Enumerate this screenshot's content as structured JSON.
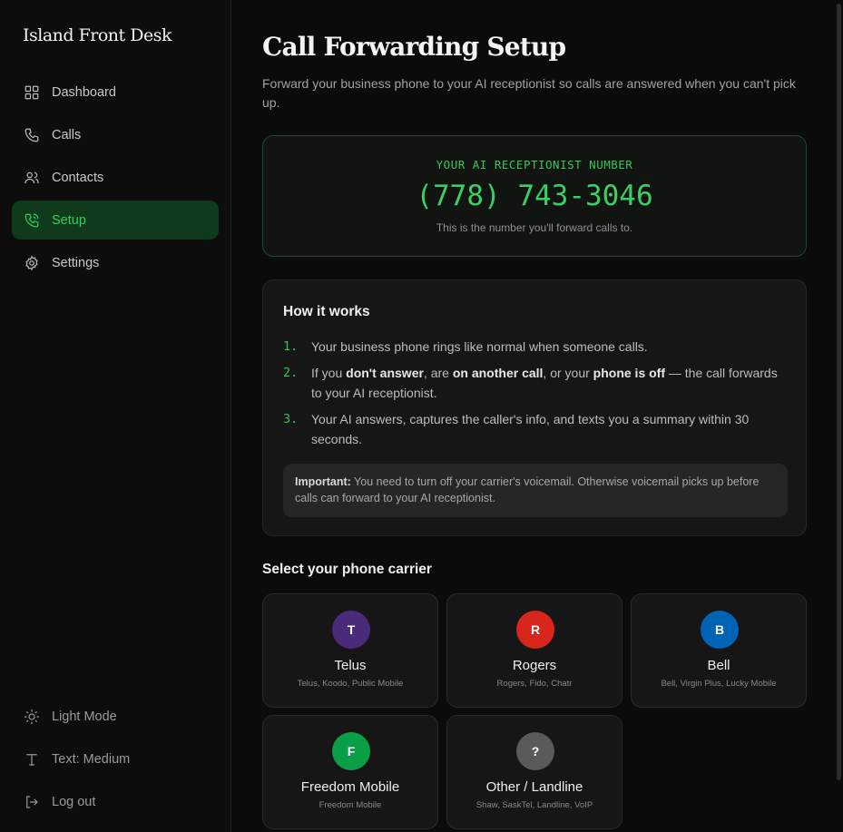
{
  "app": {
    "brand": "Island Front Desk"
  },
  "sidebar": {
    "items": [
      {
        "label": "Dashboard",
        "icon": "dashboard-icon"
      },
      {
        "label": "Calls",
        "icon": "phone-icon"
      },
      {
        "label": "Contacts",
        "icon": "users-icon"
      },
      {
        "label": "Setup",
        "icon": "phone-forward-icon",
        "active": true
      },
      {
        "label": "Settings",
        "icon": "gear-icon"
      }
    ],
    "bottom": [
      {
        "label": "Light Mode",
        "icon": "sun-icon"
      },
      {
        "label": "Text: Medium",
        "icon": "text-size-icon"
      },
      {
        "label": "Log out",
        "icon": "logout-icon"
      }
    ]
  },
  "page": {
    "title": "Call Forwarding Setup",
    "subtitle": "Forward your business phone to your AI receptionist so calls are answered when you can't pick up."
  },
  "number_card": {
    "label": "YOUR AI RECEPTIONIST NUMBER",
    "number": "(778) 743-3046",
    "note": "This is the number you'll forward calls to."
  },
  "how_it_works": {
    "title": "How it works",
    "steps": [
      {
        "num": "1.",
        "text": "Your business phone rings like normal when someone calls."
      },
      {
        "num": "2.",
        "pre": "If you ",
        "b1": "don't answer",
        "mid1": ", are ",
        "b2": "on another call",
        "mid2": ", or your ",
        "b3": "phone is off",
        "post": " — the call forwards to your AI receptionist."
      },
      {
        "num": "3.",
        "text": "Your AI answers, captures the caller's info, and texts you a summary within 30 seconds."
      }
    ],
    "important_label": "Important:",
    "important_text": " You need to turn off your carrier's voicemail. Otherwise voicemail picks up before calls can forward to your AI receptionist."
  },
  "carriers": {
    "heading": "Select your phone carrier",
    "items": [
      {
        "letter": "T",
        "name": "Telus",
        "sub": "Telus, Koodo, Public Mobile",
        "color": "#4a2a7a"
      },
      {
        "letter": "R",
        "name": "Rogers",
        "sub": "Rogers, Fido, Chatr",
        "color": "#d9261c"
      },
      {
        "letter": "B",
        "name": "Bell",
        "sub": "Bell, Virgin Plus, Lucky Mobile",
        "color": "#0063b4"
      },
      {
        "letter": "F",
        "name": "Freedom Mobile",
        "sub": "Freedom Mobile",
        "color": "#0a9e47"
      },
      {
        "letter": "?",
        "name": "Other / Landline",
        "sub": "Shaw, SaskTel, Landline, VoIP",
        "color": "#5a5a5a"
      }
    ]
  },
  "colors": {
    "accent": "#34c759",
    "active_bg": "#0f3b1c"
  }
}
